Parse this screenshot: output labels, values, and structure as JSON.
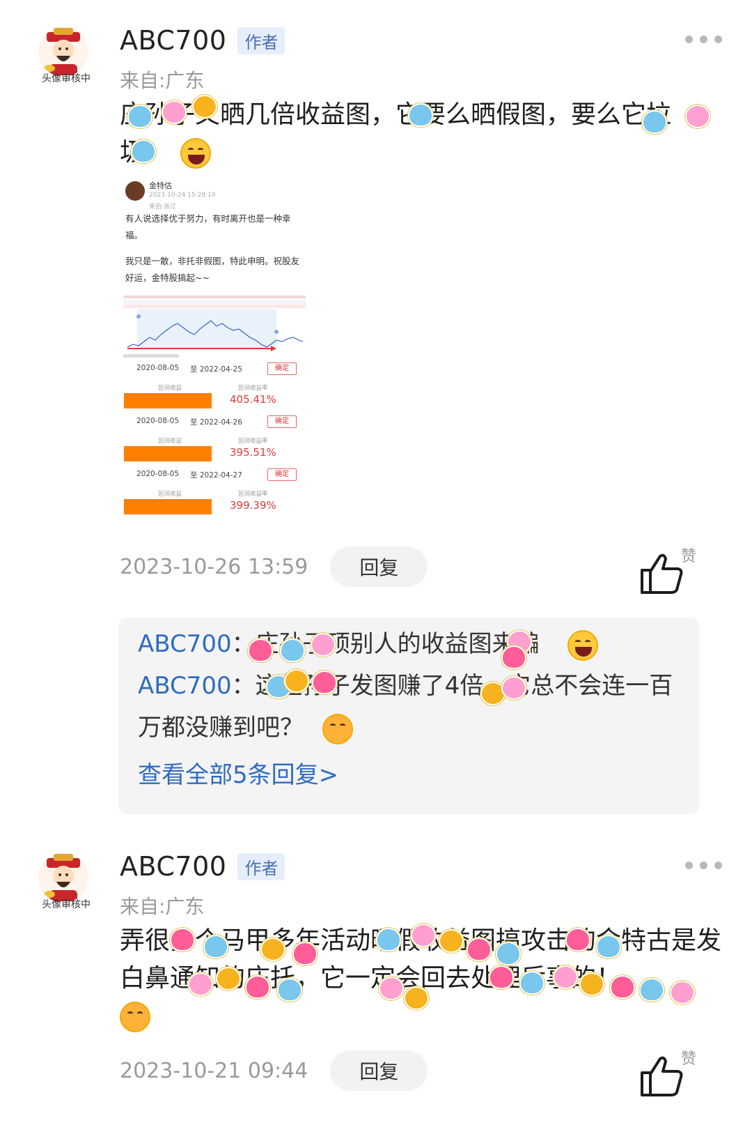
{
  "comments": [
    {
      "username": "ABC700",
      "author_tag": "作者",
      "avatar_badge": "头像审核中",
      "location": "来自:广东",
      "text_part1": "庄孙子又晒几倍收益图，它要么晒假图，要么它垃",
      "text_part2": "圾",
      "time": "2023-10-26 13:59",
      "reply_label": "回复",
      "like_label": "赞",
      "shared_post": {
        "author": "金特估",
        "time": "2023-10-24 15:28:10",
        "location": "来自:浙江",
        "text1": "有人说选择优于努力，有时离开也是一种幸福。",
        "text2": "我只是一散，非托非假图，特此申明。祝股友好运，金特股搞起~~",
        "ranges": [
          {
            "from": "2020-08-05",
            "to": "至 2022-04-25",
            "ok": "确定",
            "label_left": "区间收益",
            "label_right": "区间收益率",
            "pct": "405.41%"
          },
          {
            "from": "2020-08-05",
            "to": "至 2022-04-26",
            "ok": "确定",
            "label_left": "区间收益",
            "label_right": "区间收益率",
            "pct": "395.51%"
          },
          {
            "from": "2020-08-05",
            "to": "至 2022-04-27",
            "ok": "确定",
            "label_left": "区间收益",
            "label_right": "区间收益率",
            "pct": "399.39%"
          }
        ]
      },
      "replies": [
        {
          "user": "ABC700",
          "sep": "：",
          "text": "庄孙子顶别人的收益图来骗"
        },
        {
          "user": "ABC700",
          "sep": "：",
          "text": "这些孙子发图赚了4倍，它总不会连一百万都没赚到吧？"
        }
      ],
      "view_all": "查看全部5条回复>"
    },
    {
      "username": "ABC700",
      "author_tag": "作者",
      "avatar_badge": "头像审核中",
      "location": "来自:广东",
      "text": "弄很多个马甲多年活动晒假收益图搞攻击的金特古是发白鼻通知的庄托，它一定会回去处理后事的！",
      "time": "2023-10-21 09:44",
      "reply_label": "回复",
      "like_label": "赞"
    }
  ]
}
